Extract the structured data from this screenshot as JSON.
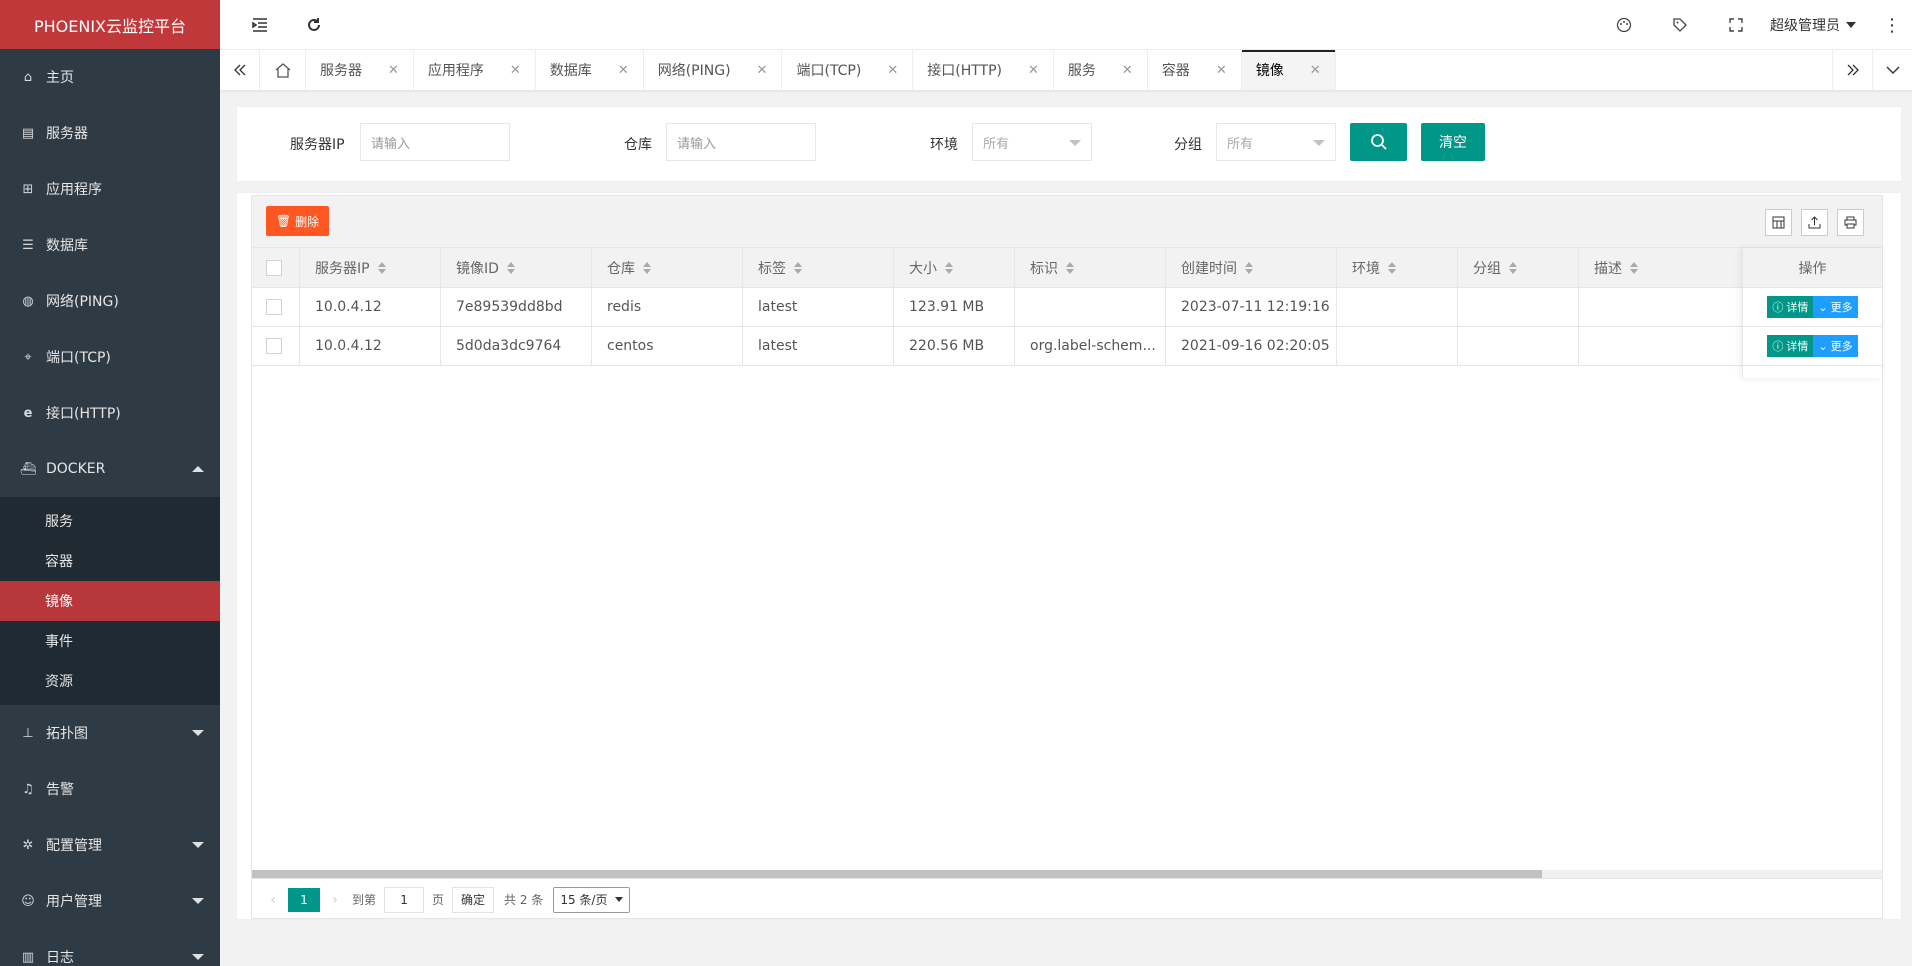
{
  "app": {
    "title": "PHOENIX云监控平台"
  },
  "sidebar": {
    "items": [
      {
        "label": "主页",
        "icon": "home-icon"
      },
      {
        "label": "服务器",
        "icon": "server-icon"
      },
      {
        "label": "应用程序",
        "icon": "app-icon"
      },
      {
        "label": "数据库",
        "icon": "database-icon"
      },
      {
        "label": "网络(PING)",
        "icon": "globe-icon"
      },
      {
        "label": "端口(TCP)",
        "icon": "port-icon"
      },
      {
        "label": "接口(HTTP)",
        "icon": "ie-icon"
      },
      {
        "label": "DOCKER",
        "icon": "docker-icon"
      }
    ],
    "docker_sub": [
      "服务",
      "容器",
      "镜像",
      "事件",
      "资源"
    ],
    "items_after": [
      {
        "label": "拓扑图",
        "icon": "topology-icon"
      },
      {
        "label": "告警",
        "icon": "bell-icon"
      },
      {
        "label": "配置管理",
        "icon": "gear-icon"
      },
      {
        "label": "用户管理",
        "icon": "user-icon"
      },
      {
        "label": "日志",
        "icon": "log-icon"
      }
    ]
  },
  "header": {
    "user": "超级管理员"
  },
  "tabs": [
    "服务器",
    "应用程序",
    "数据库",
    "网络(PING)",
    "端口(TCP)",
    "接口(HTTP)",
    "服务",
    "容器",
    "镜像"
  ],
  "filter": {
    "server_ip_label": "服务器IP",
    "server_ip_placeholder": "请输入",
    "repo_label": "仓库",
    "repo_placeholder": "请输入",
    "env_label": "环境",
    "env_value": "所有",
    "group_label": "分组",
    "group_value": "所有",
    "clear_label": "清空"
  },
  "toolbar": {
    "delete_label": "删除"
  },
  "table": {
    "columns": [
      "服务器IP",
      "镜像ID",
      "仓库",
      "标签",
      "大小",
      "标识",
      "创建时间",
      "环境",
      "分组",
      "描述"
    ],
    "op_header": "操作",
    "rows": [
      [
        "10.0.4.12",
        "7e89539dd8bd",
        "redis",
        "latest",
        "123.91 MB",
        "",
        "2023-07-11 12:19:16",
        "",
        "",
        ""
      ],
      [
        "10.0.4.12",
        "5d0da3dc9764",
        "centos",
        "latest",
        "220.56 MB",
        "org.label-schem...",
        "2021-09-16 02:20:05",
        "",
        "",
        ""
      ]
    ],
    "detail_label": "详情",
    "more_label": "更多"
  },
  "pager": {
    "current": "1",
    "goto_label": "到第",
    "goto_value": "1",
    "page_label": "页",
    "confirm_label": "确定",
    "total": "共 2 条",
    "page_size": "15 条/页"
  }
}
